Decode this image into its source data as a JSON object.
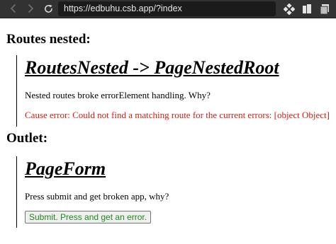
{
  "browser": {
    "url": "https://edbuhu.csb.app/?index",
    "back_icon": "chevron-left-icon",
    "forward_icon": "chevron-right-icon",
    "reload_icon": "reload-icon",
    "tools": [
      "extensions-icon",
      "tabs-icon",
      "pages-icon"
    ]
  },
  "routes_section": {
    "heading": "Routes nested:",
    "title": "RoutesNested -> PageNestedRoot",
    "description": "Nested routes broke errorElement handling. Why?",
    "error": "Cause error: Could not find a matching route for the current errors: [object Object]"
  },
  "outlet_section": {
    "heading": "Outlet:",
    "title": "PageForm",
    "description": "Press submit and get broken app, why?",
    "submit_label": "Submit. Press and get an error."
  },
  "colors": {
    "error": "#e0190e",
    "button_text": "#1c8a1c"
  }
}
